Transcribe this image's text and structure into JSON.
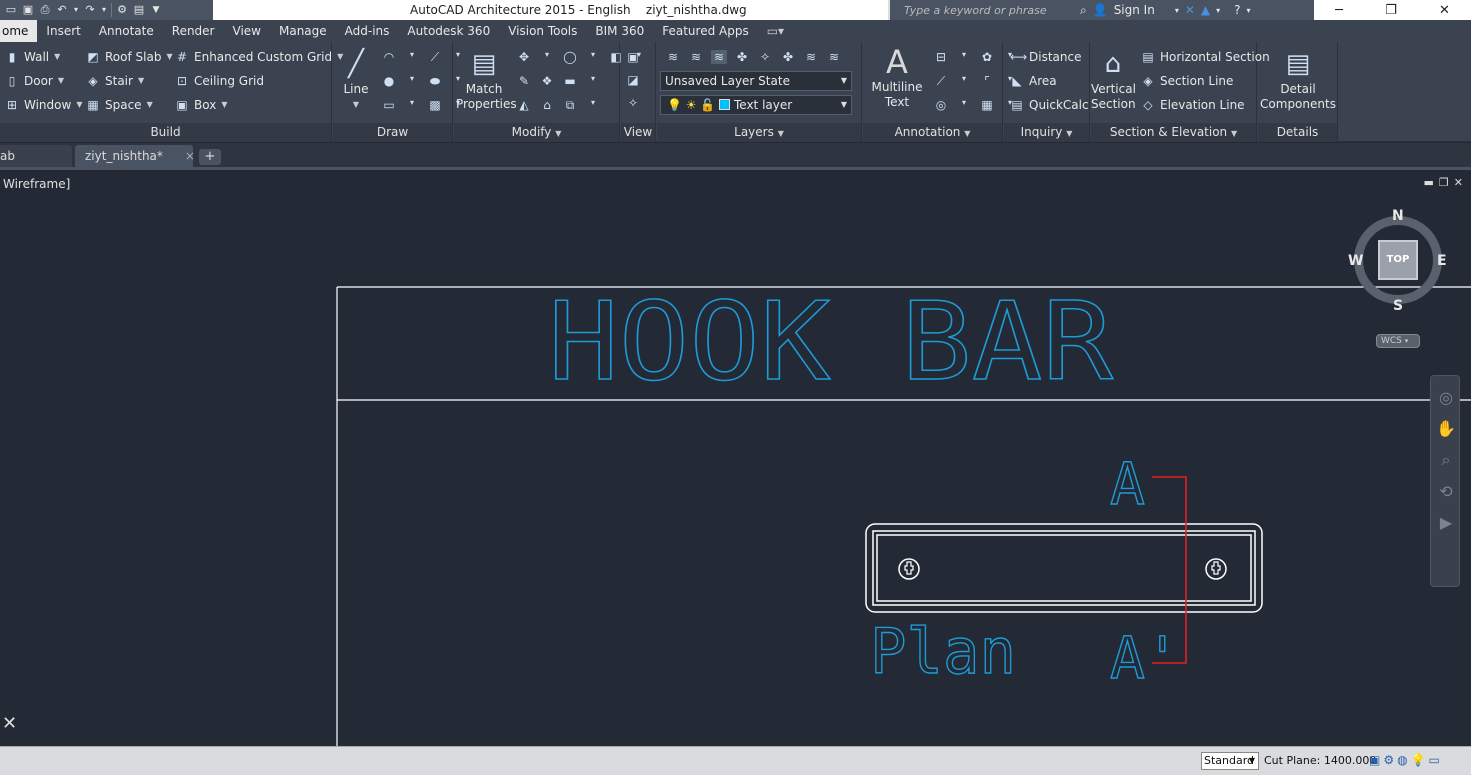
{
  "title_bar": {
    "app_title": "AutoCAD Architecture 2015 - English",
    "file_name": "ziyt_nishtha.dwg",
    "search_placeholder": "Type a keyword or phrase",
    "sign_in": "Sign In"
  },
  "menu_tabs": [
    {
      "label": "ome"
    },
    {
      "label": "Insert"
    },
    {
      "label": "Annotate"
    },
    {
      "label": "Render"
    },
    {
      "label": "View"
    },
    {
      "label": "Manage"
    },
    {
      "label": "Add-ins"
    },
    {
      "label": "Autodesk 360"
    },
    {
      "label": "Vision Tools"
    },
    {
      "label": "BIM 360"
    },
    {
      "label": "Featured Apps"
    }
  ],
  "ribbon": {
    "build": {
      "title": "Build",
      "wall": "Wall",
      "door": "Door",
      "window": "Window",
      "roof_slab": "Roof Slab",
      "stair": "Stair",
      "space": "Space",
      "enhanced_grid": "Enhanced Custom Grid",
      "ceiling_grid": "Ceiling Grid",
      "box": "Box"
    },
    "draw": {
      "title": "Draw",
      "line": "Line"
    },
    "modify": {
      "title": "Modify",
      "match_properties_1": "Match",
      "match_properties_2": "Properties"
    },
    "view": {
      "title": "View"
    },
    "layers": {
      "title": "Layers",
      "layer_state": "Unsaved Layer State",
      "current_layer": "Text layer",
      "layer_color": "#00bfff"
    },
    "annotation": {
      "title": "Annotation",
      "multiline_1": "Multiline",
      "multiline_2": "Text"
    },
    "inquiry": {
      "title": "Inquiry",
      "distance": "Distance",
      "area": "Area",
      "quickcalc": "QuickCalc"
    },
    "section": {
      "title": "Section & Elevation",
      "vertical_1": "Vertical",
      "vertical_2": "Section",
      "horizontal": "Horizontal Section",
      "section_line": "Section Line",
      "elevation_line": "Elevation Line"
    },
    "details": {
      "title": "Details",
      "detail_1": "Detail",
      "detail_2": "Components"
    }
  },
  "file_tabs": [
    {
      "label": "ab"
    },
    {
      "label": "ziyt_nishtha*"
    }
  ],
  "viewport": {
    "label": "Wireframe]"
  },
  "drawing": {
    "title": "HOOK BAR",
    "plan_label": "Plan",
    "section_top": "A",
    "section_bottom": "A'",
    "line_color": "#ffffff",
    "text_color": "#1e9bd7",
    "section_color": "#e02020"
  },
  "viewcube": {
    "top": "TOP",
    "north": "N",
    "south": "S",
    "east": "E",
    "west": "W",
    "wcs": "WCS"
  },
  "status_bar": {
    "style": "Standard",
    "cut_plane_label": "Cut Plane:",
    "cut_plane_value": "1400.000"
  }
}
